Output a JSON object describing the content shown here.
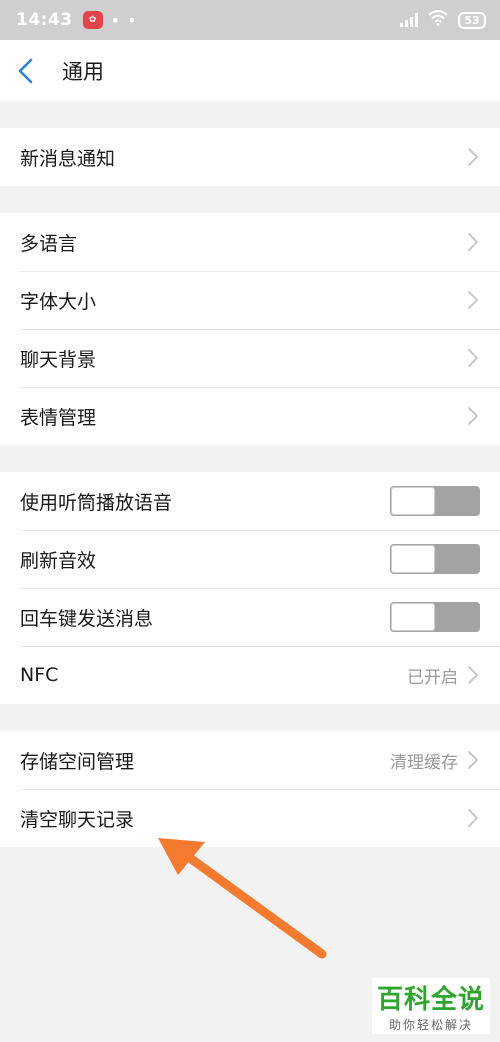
{
  "status_bar": {
    "time": "14:43",
    "app_badge": "iQiYi-like",
    "dots": "• •",
    "battery": "53"
  },
  "navbar": {
    "title": "通用"
  },
  "groups": [
    {
      "rows": [
        {
          "label": "新消息通知",
          "type": "link"
        }
      ]
    },
    {
      "rows": [
        {
          "label": "多语言",
          "type": "link"
        },
        {
          "label": "字体大小",
          "type": "link"
        },
        {
          "label": "聊天背景",
          "type": "link"
        },
        {
          "label": "表情管理",
          "type": "link"
        }
      ]
    },
    {
      "rows": [
        {
          "label": "使用听筒播放语音",
          "type": "toggle",
          "on": false
        },
        {
          "label": "刷新音效",
          "type": "toggle",
          "on": false
        },
        {
          "label": "回车键发送消息",
          "type": "toggle",
          "on": false
        },
        {
          "label": "NFC",
          "type": "link",
          "value": "已开启"
        }
      ]
    },
    {
      "rows": [
        {
          "label": "存储空间管理",
          "type": "link",
          "value": "清理缓存"
        },
        {
          "label": "清空聊天记录",
          "type": "link"
        }
      ]
    }
  ],
  "watermark": {
    "main": "百科全说",
    "sub": "助你轻松解决"
  },
  "colors": {
    "arrow": "#f47a30",
    "toggle_track": "#a3a3a3",
    "back_icon": "#2f7fe0",
    "watermark_green": "#2ea52e"
  },
  "icons": [
    "back-chevron-icon",
    "chevron-right-icon",
    "signal-icon",
    "wifi-icon",
    "battery-icon",
    "arrow-annotation-icon"
  ]
}
